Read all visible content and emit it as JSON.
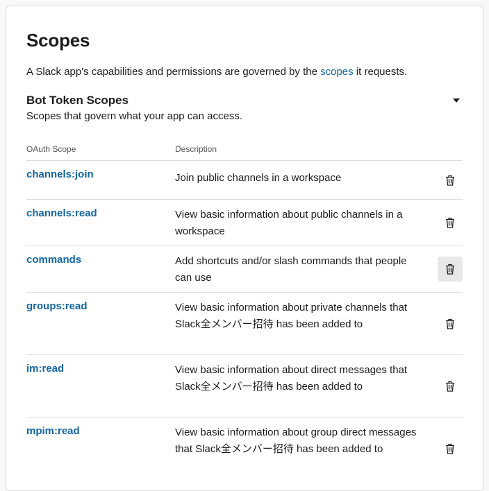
{
  "page": {
    "title": "Scopes",
    "intro_before": "A Slack app's capabilities and permissions are governed by the ",
    "intro_link": "scopes",
    "intro_after": " it requests."
  },
  "section": {
    "title": "Bot Token Scopes",
    "subtitle": "Scopes that govern what your app can access.",
    "toggle_icon": "caret-down-icon"
  },
  "table": {
    "headers": {
      "scope": "OAuth Scope",
      "description": "Description"
    },
    "rows": [
      {
        "scope": "channels:join",
        "description": "Join public channels in a workspace"
      },
      {
        "scope": "channels:read",
        "description": "View basic information about public channels in a workspace"
      },
      {
        "scope": "commands",
        "description": "Add shortcuts and/or slash commands that people can use"
      },
      {
        "scope": "groups:read",
        "description": "View basic information about private channels that Slack全メンバー招待 has been added to"
      },
      {
        "scope": "im:read",
        "description": "View basic information about direct messages that Slack全メンバー招待 has been added to"
      },
      {
        "scope": "mpim:read",
        "description": "View basic information about group direct messages that Slack全メンバー招待 has been added to"
      }
    ],
    "delete_icon": "trash-icon"
  },
  "colors": {
    "link": "#1264a3",
    "text": "#1d1c1d",
    "border": "#dddddd",
    "hover_bg": "#e8e8e8"
  }
}
